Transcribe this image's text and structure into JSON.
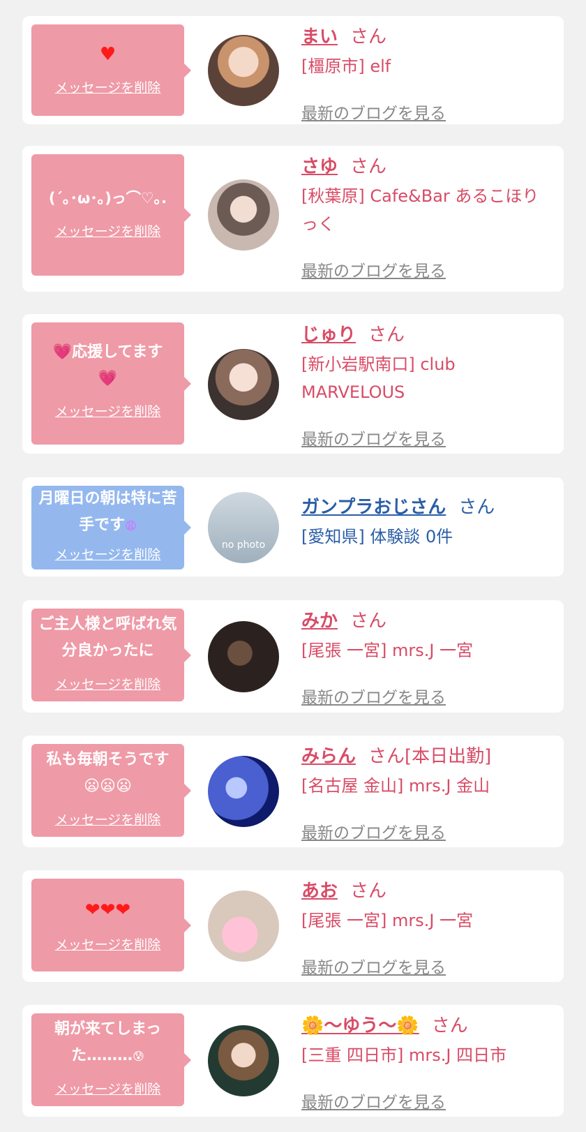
{
  "delete_label": "メッセージを削除",
  "blog_label": "最新のブログを見る",
  "suffix": "さん",
  "cards": [
    {
      "message": "♥",
      "name": "まい",
      "suffix_extra": "",
      "location": "[橿原市] elf"
    },
    {
      "message": "(´｡･ω･｡)っ⌒♡｡.",
      "name": "さゆ",
      "suffix_extra": "",
      "location": "[秋葉原] Cafe&Bar あるこほりっく"
    },
    {
      "message_pre": "💗",
      "message": "応援してます",
      "message_post": "💗",
      "name": "じゅり",
      "suffix_extra": "",
      "location": "[新小岩駅南口] club MARVELOUS"
    },
    {
      "message": "月曜日の朝は特に苦手です",
      "message_post": "😩",
      "name": "ガンプラおじさん",
      "suffix_extra": "",
      "location": "[愛知県] 体験談 0件",
      "avatar_text": "no photo"
    },
    {
      "message": "ご主人様と呼ばれ気分良かったに",
      "name": "みか",
      "suffix_extra": "",
      "location": "[尾張 一宮] mrs.J 一宮"
    },
    {
      "message": "私も毎朝そうです",
      "message_post": "😦😦😦",
      "name": "みらん",
      "suffix_extra": "[本日出勤]",
      "location": "[名古屋 金山] mrs.J 金山"
    },
    {
      "message": "❤❤❤",
      "name": "あお",
      "suffix_extra": "",
      "location": "[尾張 一宮] mrs.J 一宮"
    },
    {
      "message": "朝が来てしまった………",
      "message_post": "😰",
      "name": "🌼〜ゆう〜🌼",
      "suffix_extra": "",
      "location": "[三重 四日市] mrs.J 四日市"
    }
  ],
  "colors": {
    "pink_bubble": "#ef9aa7",
    "blue_bubble": "#94b8ee",
    "name_pink": "#d84b66",
    "name_blue": "#2a5ea8",
    "link_gray": "#888888"
  }
}
